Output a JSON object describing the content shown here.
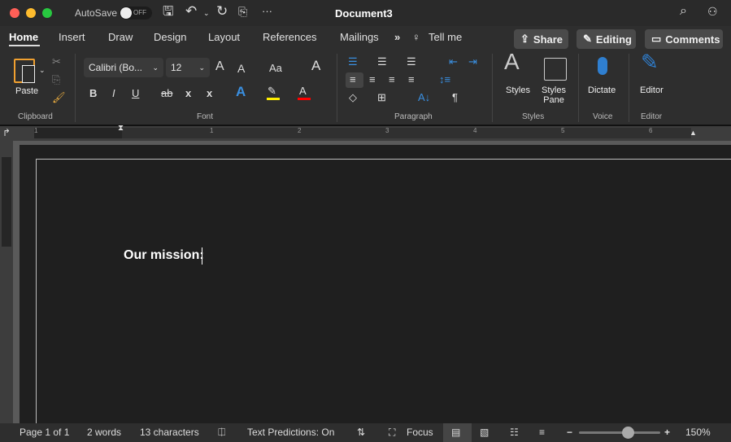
{
  "title": "Document3",
  "autosave": {
    "label": "AutoSave",
    "state": "OFF"
  },
  "tabs": [
    "Home",
    "Insert",
    "Draw",
    "Design",
    "Layout",
    "References",
    "Mailings"
  ],
  "tell_me": "Tell me",
  "buttons": {
    "share": "Share",
    "editing": "Editing",
    "comments": "Comments"
  },
  "clipboard": {
    "paste": "Paste",
    "group": "Clipboard"
  },
  "font": {
    "name": "Calibri (Bo...",
    "size": "12",
    "group": "Font",
    "highlight_color": "#ffee00",
    "font_color": "#ff0000",
    "bold": "B",
    "italic": "I",
    "underline": "U",
    "strike": "ab",
    "subscript": "x",
    "superscript": "x",
    "grow": "A",
    "shrink": "A",
    "case": "Aa"
  },
  "paragraph": {
    "group": "Paragraph",
    "pilcrow": "¶"
  },
  "styles": {
    "styles": "Styles",
    "pane_line1": "Styles",
    "pane_line2": "Pane",
    "group": "Styles"
  },
  "voice": {
    "dictate": "Dictate",
    "group": "Voice"
  },
  "editor": {
    "editor": "Editor",
    "group": "Editor"
  },
  "ruler": {
    "labels": [
      "1",
      "1",
      "2",
      "3",
      "4",
      "5",
      "6"
    ]
  },
  "document": {
    "text": "Our mission:"
  },
  "status": {
    "page": "Page 1 of 1",
    "words": "2 words",
    "characters": "13 characters",
    "predictions": "Text Predictions: On",
    "focus": "Focus",
    "zoom": "150%",
    "zoom_level": 0.6
  }
}
